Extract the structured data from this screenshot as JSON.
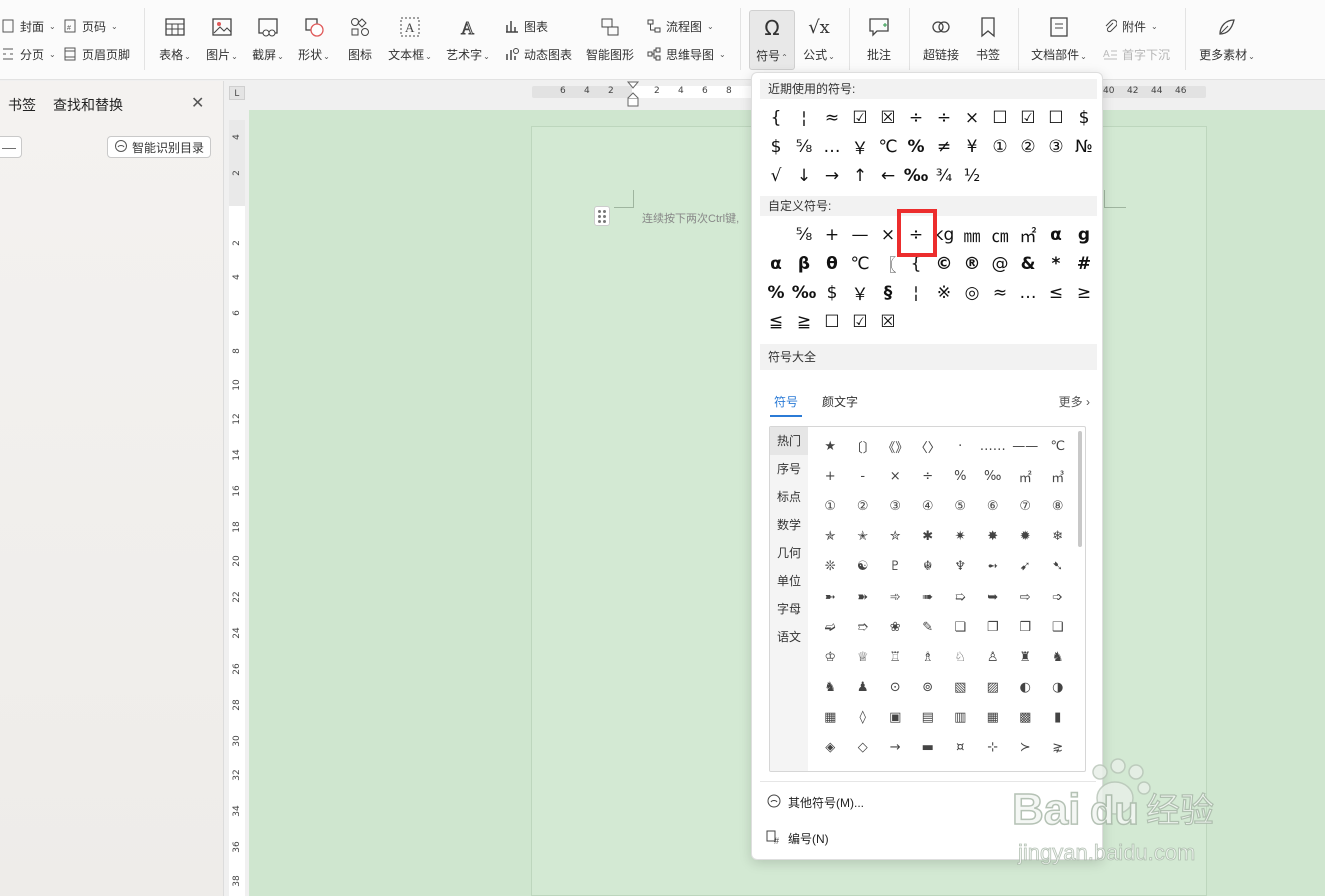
{
  "ribbon": {
    "cover": "封面",
    "page_break": "分页",
    "page_number": "页码",
    "header_footer": "页眉页脚",
    "table": "表格",
    "picture": "图片",
    "screenshot": "截屏",
    "shape": "形状",
    "icon": "图标",
    "textbox": "文本框",
    "wordart": "艺术字",
    "chart": "图表",
    "dynamic_chart": "动态图表",
    "smart_graphic": "智能图形",
    "flowchart": "流程图",
    "mindmap": "思维导图",
    "symbol": "符号",
    "formula": "公式",
    "comment": "批注",
    "hyperlink": "超链接",
    "bookmark": "书签",
    "doc_parts": "文档部件",
    "attachment": "附件",
    "drop_cap": "首字下沉",
    "more_material": "更多素材"
  },
  "left_panel": {
    "tab_bookmarks": "书签",
    "tab_find_replace": "查找和替换",
    "close_glyph": "✕",
    "minus_glyph": "—",
    "smart_toc_button": "智能识别目录"
  },
  "hruler_ticks": [
    "6",
    "4",
    "2",
    "2",
    "4",
    "6",
    "8",
    "1",
    "40",
    "42",
    "44",
    "46"
  ],
  "vruler_ticks": [
    "4",
    "2",
    "2",
    "4",
    "6",
    "8",
    "10",
    "12",
    "14",
    "16",
    "18",
    "20",
    "22",
    "24",
    "26",
    "28",
    "30",
    "32",
    "34",
    "36",
    "38"
  ],
  "ruler_corner": "L",
  "document": {
    "hint": "连续按下两次Ctrl键,"
  },
  "symbol_dropdown": {
    "recent_title": "近期使用的符号:",
    "recent_symbols": [
      "{",
      "¦",
      "≈",
      "☑",
      "☒",
      "÷",
      "÷",
      "×",
      "☐",
      "☑",
      "☐",
      "$",
      "$",
      "⅝",
      "…",
      "￥",
      "℃",
      "%",
      "≠",
      "¥",
      "①",
      "②",
      "③",
      "№",
      "√",
      "↓",
      "→",
      "↑",
      "←",
      "‰",
      "¾",
      "½"
    ],
    "custom_title": "自定义符号:",
    "custom_symbols": [
      "",
      "⅝",
      "+",
      "—",
      "×",
      "÷",
      "kg",
      "㎜",
      "㎝",
      "㎡",
      "α",
      "g",
      "α",
      "β",
      "θ",
      "℃",
      "〖",
      "{",
      "©",
      "®",
      "@",
      "&",
      "*",
      "#",
      "%",
      "‰",
      "$",
      "￥",
      "§",
      "¦",
      "※",
      "◎",
      "≈",
      "…",
      "≤",
      "≥",
      "≦",
      "≧",
      "☐",
      "☑",
      "☒"
    ],
    "library_title": "符号大全",
    "tab_symbols": "符号",
    "tab_kaomoji": "颜文字",
    "more": "更多",
    "categories": [
      "热门",
      "序号",
      "标点",
      "数学",
      "几何",
      "单位",
      "字母",
      "语文"
    ],
    "library_symbols": [
      "★",
      "〔〕",
      "《》",
      "〈〉",
      "·",
      "……",
      "——",
      "℃",
      "+",
      "-",
      "×",
      "÷",
      "%",
      "‰",
      "㎡",
      "㎥",
      "①",
      "②",
      "③",
      "④",
      "⑤",
      "⑥",
      "⑦",
      "⑧",
      "✯",
      "✭",
      "✮",
      "✱",
      "✷",
      "✸",
      "✹",
      "❄",
      "❊",
      "☯",
      "♇",
      "☬",
      "♆",
      "➻",
      "➹",
      "➷",
      "➼",
      "➽",
      "➾",
      "➠",
      "➯",
      "➥",
      "⇨",
      "➩",
      "➫",
      "➱",
      "❀",
      "✎",
      "❏",
      "❐",
      "❒",
      "❑",
      "♔",
      "♕",
      "♖",
      "♗",
      "♘",
      "♙",
      "♜",
      "♞",
      "♞",
      "♟",
      "⊙",
      "⊚",
      "▧",
      "▨",
      "◐",
      "◑",
      "▦",
      "◊",
      "▣",
      "▤",
      "▥",
      "▦",
      "▩",
      "▮",
      "◈",
      "◇",
      "→",
      "▬",
      "¤",
      "⊹",
      "≻",
      "⋧"
    ],
    "other_symbols": "其他符号(M)...",
    "numbering": "编号(N)"
  },
  "watermark": {
    "brand": "Baidu经验",
    "url": "jingyan.baidu.com"
  },
  "colors": {
    "workspace_bg": "#cfe6cf",
    "highlight": "#ec2d2d",
    "accent": "#2b7bd6"
  }
}
